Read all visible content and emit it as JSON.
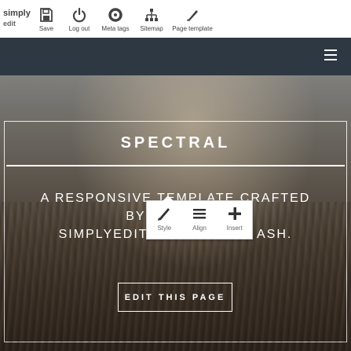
{
  "editor": {
    "brand_line1": "simply",
    "brand_line2": "edit",
    "tools": [
      {
        "icon": "save-icon",
        "label": "Save"
      },
      {
        "icon": "logout-icon",
        "label": "Log out"
      },
      {
        "icon": "meta-tags-icon",
        "label": "Meta tags"
      },
      {
        "icon": "sitemap-icon",
        "label": "Sitemap"
      },
      {
        "icon": "page-template-icon",
        "label": "Page template"
      }
    ]
  },
  "site": {
    "menu_icon": "hamburger-icon",
    "title": "SPECTRAL",
    "tagline_line1": "A RESPONSIVE TEMPLATE CRAFTED",
    "tagline_line2": "BY HTML5 UP",
    "tagline_line3": "SIMPLYEDIT.IM",
    "tagline_line3_tail": "ASH.",
    "cta": "EDIT THIS PAGE"
  },
  "text_popup": {
    "tools": [
      {
        "icon": "style-icon",
        "label": "Style"
      },
      {
        "icon": "align-icon",
        "label": "Align"
      },
      {
        "icon": "insert-icon",
        "label": "Insert"
      }
    ]
  },
  "colors": {
    "header_bg": "#2e3842",
    "toolbar_bg": "#ffffff",
    "text_on_banner": "#ffffff"
  }
}
